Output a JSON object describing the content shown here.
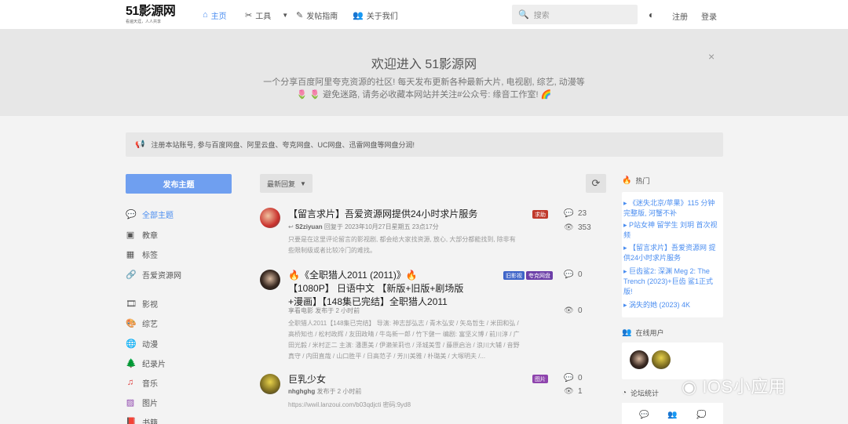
{
  "header": {
    "logo_main": "51影源网",
    "logo_sub": "看遍天涯，人人共享",
    "nav": [
      {
        "label": "主页",
        "icon": "home-icon"
      },
      {
        "label": "工具",
        "icon": "tools-icon"
      },
      {
        "label": "发帖指南",
        "icon": "pen-icon"
      },
      {
        "label": "关于我们",
        "icon": "users-icon"
      }
    ],
    "search_placeholder": "搜索",
    "register": "注册",
    "login": "登录"
  },
  "banner": {
    "title": "欢迎进入 51影源网",
    "line1": "一个分享百度阿里夸克资源的社区! 每天发布更新各种最新大片, 电视剧, 综艺, 动漫等",
    "line2": "🌷 🌷 避免迷路, 请务必收藏本网站并关注#公众号: 缘音工作室! 🌈",
    "close": "×"
  },
  "notice": "注册本站账号, 参与百度网盘、阿里云盘、夸克网盘、UC网盘、迅雷网盘等网盘分润!",
  "sidebar": {
    "publish_button": "发布主题",
    "items": [
      {
        "label": "全部主题",
        "icon": "chat-icon"
      },
      {
        "label": "教章",
        "icon": "badge-icon"
      },
      {
        "label": "标签",
        "icon": "grid-icon"
      },
      {
        "label": "吾爱资源网",
        "icon": "link-icon"
      },
      {
        "label": "影视",
        "icon": "film-icon"
      },
      {
        "label": "综艺",
        "icon": "palette-icon"
      },
      {
        "label": "动漫",
        "icon": "globe-icon"
      },
      {
        "label": "纪录片",
        "icon": "tree-icon"
      },
      {
        "label": "音乐",
        "icon": "music-icon"
      },
      {
        "label": "图片",
        "icon": "image-icon"
      },
      {
        "label": "书籍",
        "icon": "book-icon"
      }
    ]
  },
  "toolbar": {
    "sort_label": "最新回复",
    "refresh_icon": "refresh-icon"
  },
  "threads": [
    {
      "title": "【留言求片】吾爱资源网提供24小时求片服务",
      "user": "S2ziyuan",
      "meta": "回复于 2023年10月27日星期五 23点17分",
      "body_line1": "只要是在这里评论留言的影视剧, 都会给大家找资源, 放心, 大部分都能找到, 除非有",
      "body_line2": "些限制级或者比较冷门的难找。",
      "tags": [
        "求助"
      ],
      "replies": "23",
      "views": "353"
    },
    {
      "title_line1": "🔥《全职猎人2011 (2011)》🔥",
      "title_line2": "【1080P】 日语中文 【新版+旧版+剧场版",
      "title_line3": "+漫画】【148集已完结】全职猎人2011",
      "user": "享看电影",
      "meta": "发布于 2 小时前",
      "body_line1": "全职猎人2011【148集已完结】 导演: 神志部弘志 / 青木弘安 / 矢岛哲生 / 米田和弘 /",
      "body_line2": "高桥知也 / 松村政辉 / 友田政晴 / 牛岛新一郎 / 竹下健一 编剧: 富坚义博 / 前川淳 / 广",
      "body_line3": "田光毅 / 米村正二 主演: 潘惠美 / 伊濑茉莉也 / 泽城美雪 / 藤原启治 / 浪川大辅 / 音野",
      "body_line4": "真守 / 内田直哉 / 山口胜平 / 日高范子 / 芳川美雅 / 朴璐美 / 大塚明夫 /...",
      "tags": [
        "旧影视",
        "夸克网盘"
      ],
      "replies": "0",
      "views": "0"
    },
    {
      "title": "巨乳少女",
      "user": "nhghghg",
      "meta": "发布于 2 小时前",
      "body_line1": "https://wwil.lanzoui.com/b03qdjcti 密码:9yd8",
      "tags": [
        "图片"
      ],
      "replies": "0",
      "views": "1"
    }
  ],
  "right": {
    "hot_title": "热门",
    "hot_items": [
      "《迷失北京/苹果》115 分钟完整版, 河蟹不补",
      "P站女神 留学生 刘玥 首次视频",
      "【留言求片】吾爱资源网 提供24小时求片服务",
      "巨齿鲨2: 深渊 Meg 2: The Trench (2023)+巨齿 鲨1正式版!",
      "涡失的她 (2023) 4K"
    ],
    "online_title": "在线用户",
    "stats_title": "论坛统计"
  },
  "watermark": "IOS小应用",
  "colors": {
    "accent": "#4a8df0",
    "publish": "#6f9ff0",
    "tag_help": "#c0392b",
    "tag_old": "#3e64c8",
    "tag_quark": "#6c3fa8",
    "tag_pic": "#8e44ad"
  }
}
